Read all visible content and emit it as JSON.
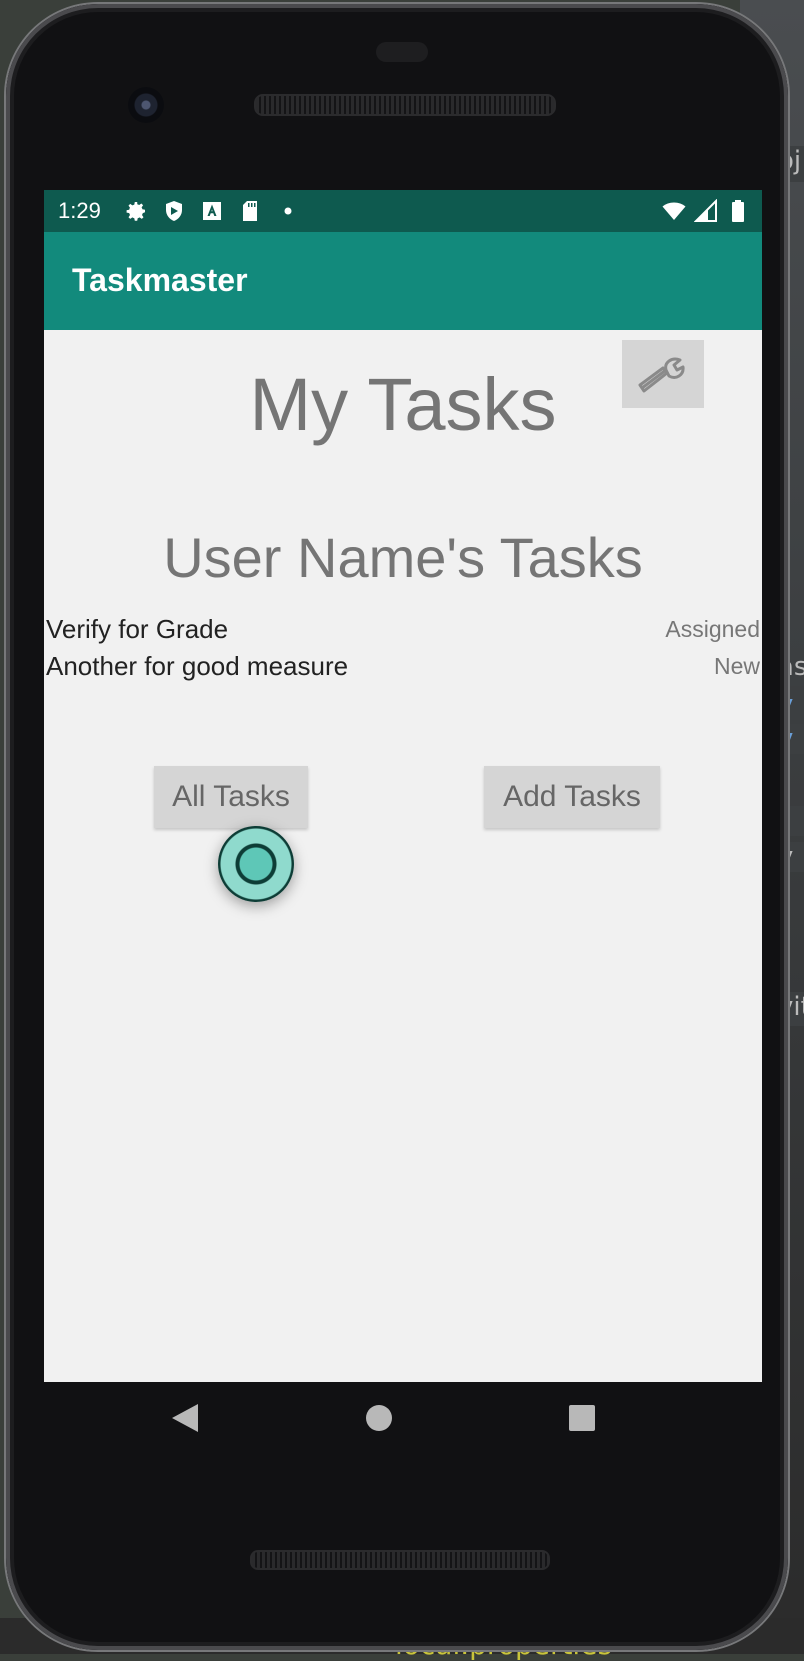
{
  "status_bar": {
    "time": "1:29",
    "left_icons": [
      "gear-icon",
      "shield-icon",
      "font-a-icon",
      "sd-card-icon",
      "dot-icon"
    ],
    "right_icons": [
      "wifi-icon",
      "signal-icon",
      "battery-icon"
    ]
  },
  "app_bar": {
    "title": "Taskmaster"
  },
  "main": {
    "settings_icon": "wrench-icon",
    "title": "My Tasks",
    "user_heading": "User Name's Tasks",
    "tasks": [
      {
        "title": "Verify for Grade",
        "state": "Assigned"
      },
      {
        "title": "Another for good measure",
        "state": "New"
      }
    ],
    "buttons": {
      "all_tasks": "All Tasks",
      "add_tasks": "Add Tasks"
    }
  },
  "nav_bar": {
    "icons": [
      "back-icon",
      "home-icon",
      "recents-icon"
    ]
  },
  "background": {
    "file_label": "local.properties",
    "strip_texts": [
      "oj",
      "as",
      "y",
      "v",
      "r",
      "y",
      "vit"
    ]
  },
  "colors": {
    "status_bar": "#0e5a4f",
    "app_bar": "#128a7c",
    "screen_bg": "#f1f1f1",
    "button_bg": "#d5d5d5",
    "title_text": "#757575"
  }
}
